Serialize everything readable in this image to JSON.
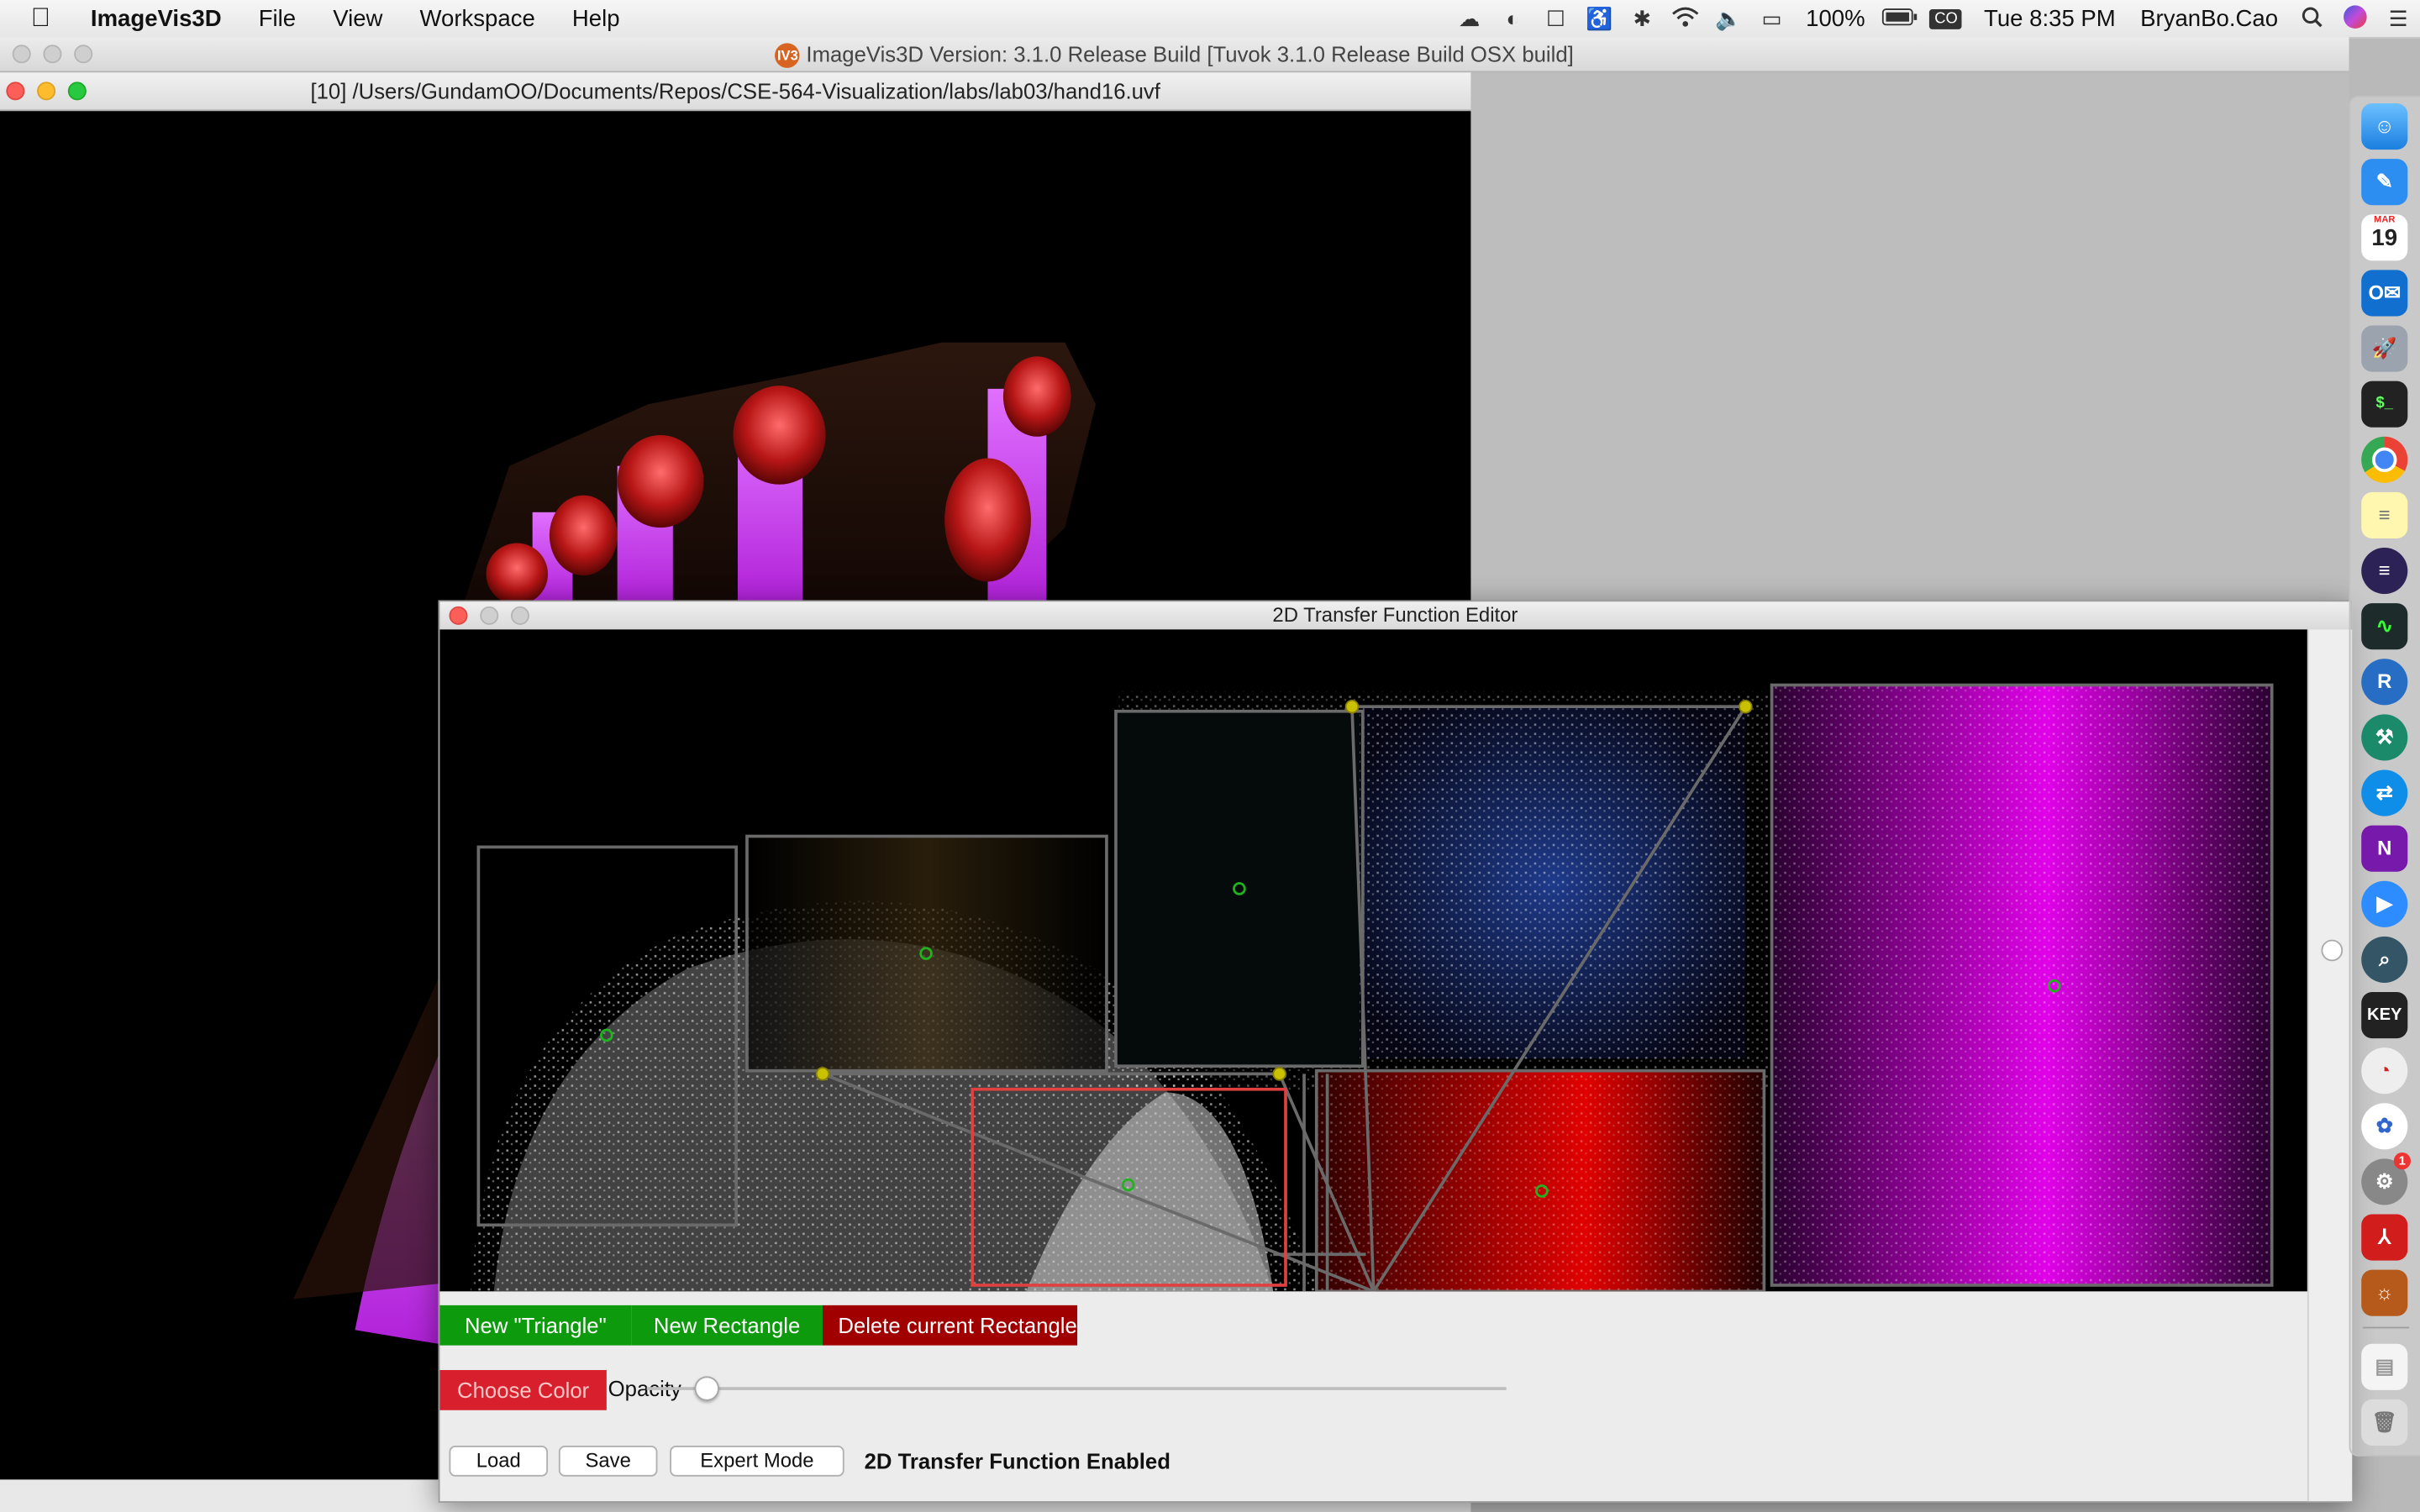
{
  "menubar": {
    "app_name": "ImageVis3D",
    "menus": [
      "File",
      "View",
      "Workspace",
      "Help"
    ],
    "battery": "100%",
    "clock": "Tue 8:35 PM",
    "user": "BryanBo.Cao",
    "input_badge": "CO"
  },
  "app_window": {
    "title": "ImageVis3D Version: 3.1.0 Release Build [Tuvok 3.1.0 Release Build OSX build]",
    "badge": "IV3"
  },
  "render_window": {
    "title": "[10] /Users/GundamOO/Documents/Repos/CSE-564-Visualization/labs/lab03/hand16.uvf"
  },
  "tf_editor": {
    "title": "2D Transfer Function Editor",
    "new_triangle": "New \"Triangle\"",
    "new_rectangle": "New Rectangle",
    "delete_rectangle": "Delete current Rectangle",
    "choose_color": "Choose Color",
    "opacity_label": "Opacity",
    "opacity": 0.07,
    "load": "Load",
    "save": "Save",
    "expert_mode": "Expert Mode",
    "status": "2D Transfer Function Enabled"
  },
  "dock": {
    "icons": [
      "finder-icon",
      "pen-icon",
      "calendar-icon",
      "outlook-icon",
      "rocket-icon",
      "terminal-icon",
      "chrome-icon",
      "notes-icon",
      "eclipse-icon",
      "activity-monitor-icon",
      "r-icon",
      "xcode-icon",
      "teamviewer-icon",
      "onenote-icon",
      "zoom-icon",
      "search-app-icon",
      "keynote-icon",
      "circle-app-icon",
      "colors-icon",
      "system-preferences-icon",
      "acrobat-icon",
      "imagevis3d-icon",
      "document-icon",
      "trash-icon"
    ],
    "calendar_day": "19",
    "calendar_month": "MAR",
    "onenote_letter": "N",
    "outlook_letter": "O",
    "r_letter": "R",
    "keynote_text": "KEY",
    "sysprefs_badge": "1"
  },
  "colors": {
    "green_button": "#0d9a0d",
    "delete_button": "#a00000",
    "choose_color": "#d71f2d",
    "selected_rect": "#e04040"
  }
}
